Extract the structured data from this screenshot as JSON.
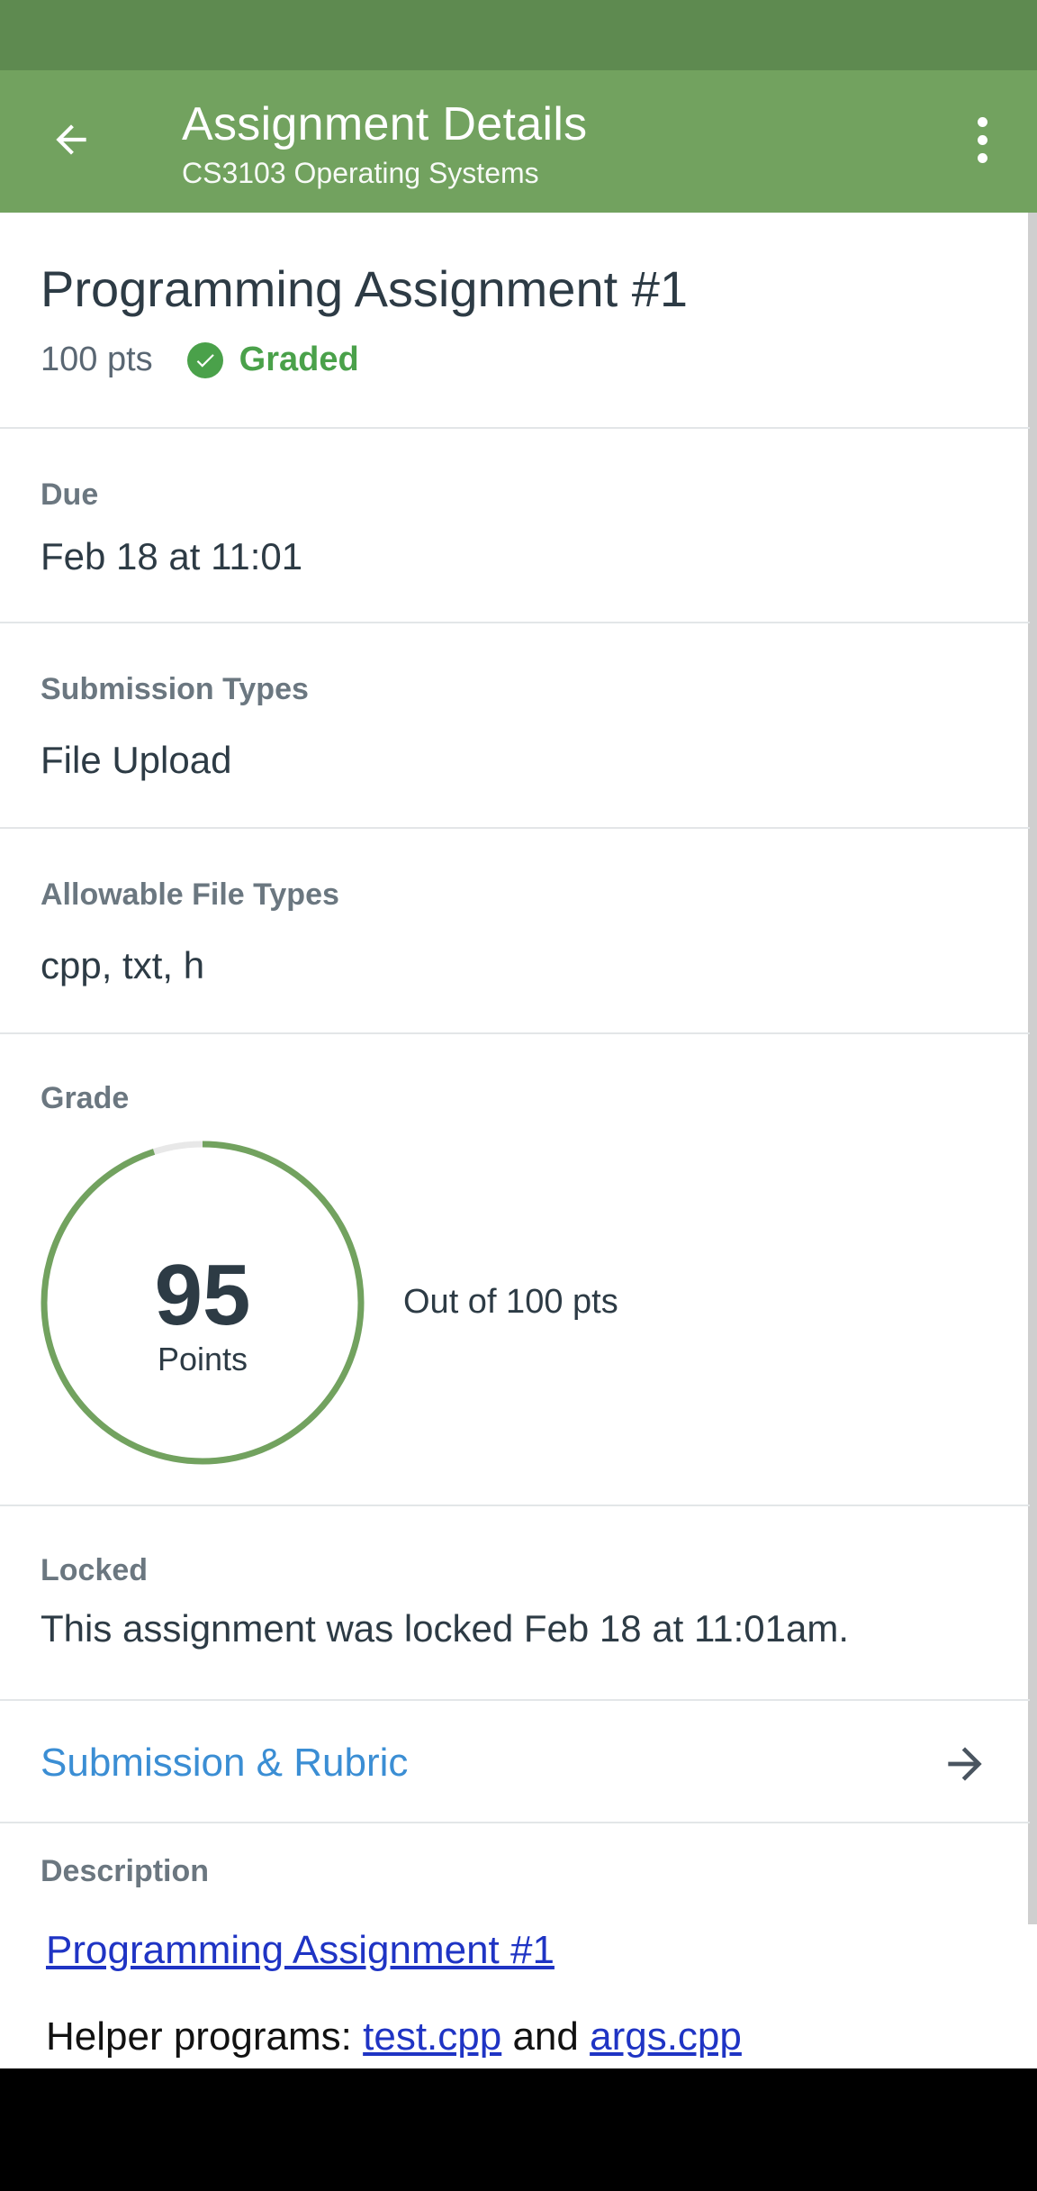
{
  "app_bar": {
    "title": "Assignment Details",
    "subtitle": "CS3103 Operating Systems",
    "back_icon": "arrow-left-icon",
    "menu_icon": "more-vertical-icon"
  },
  "assignment": {
    "title": "Programming Assignment #1",
    "points": "100 pts",
    "status": "Graded"
  },
  "due": {
    "label": "Due",
    "value": "Feb 18 at 11:01"
  },
  "submission_types": {
    "label": "Submission Types",
    "value": "File Upload"
  },
  "file_types": {
    "label": "Allowable File Types",
    "value": "cpp, txt, h"
  },
  "grade": {
    "label": "Grade",
    "score": "95",
    "unit": "Points",
    "out_of": "Out of 100 pts",
    "fraction": 0.95
  },
  "locked": {
    "label": "Locked",
    "value": "This assignment was locked Feb 18 at 11:01am."
  },
  "rubric": {
    "label": "Submission & Rubric"
  },
  "description": {
    "label": "Description",
    "link_title": "Programming Assignment #1",
    "helper_prefix": "Helper programs: ",
    "helper_file_1": "test.cpp",
    "helper_and": " and ",
    "helper_file_2": "args.cpp"
  },
  "colors": {
    "primary": "#72a25f",
    "status_bar": "#5e8a50",
    "graded_green": "#4aa14a",
    "link_blue": "#3b8ed4"
  }
}
